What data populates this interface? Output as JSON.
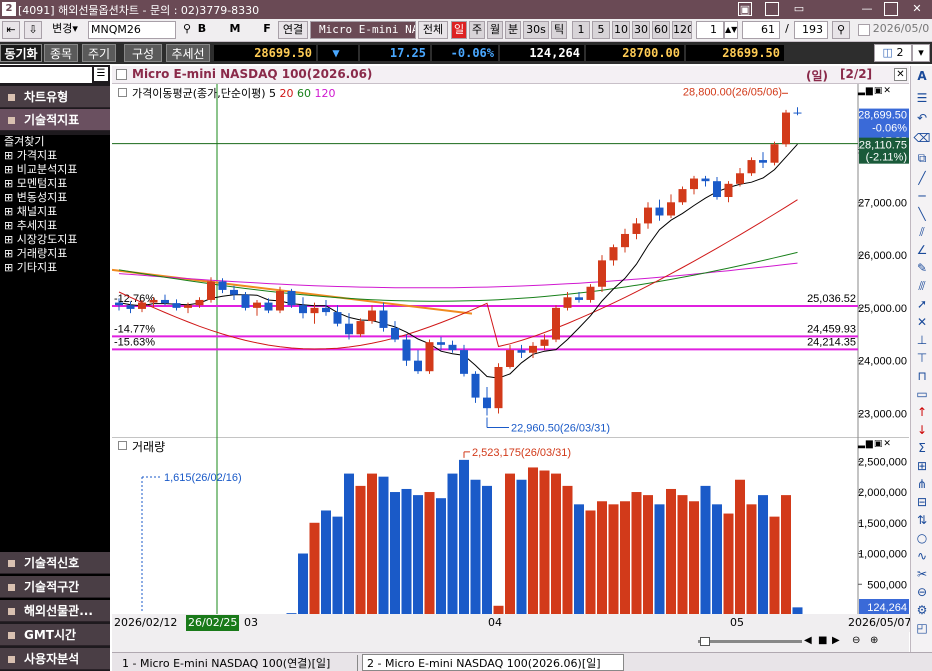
{
  "titlebar": {
    "title": "[4091] 해외선물옵션차트 - 문의 : 02)3779-8330",
    "num": "2",
    "buttons": [
      "▣",
      "□",
      "▭",
      "—",
      "□",
      "✕"
    ]
  },
  "toolbar1": {
    "change_label": "변경",
    "symbol": "MNQM26",
    "b": "B",
    "m": "M",
    "f": "F",
    "link": "연결",
    "name": "Micro E-mini NAS",
    "all": "전체",
    "periods": [
      "일",
      "주",
      "월",
      "분",
      "30s",
      "틱"
    ],
    "nums": [
      "1",
      "5",
      "10",
      "30",
      "60",
      "120"
    ],
    "count_a": "1",
    "count_b": "61",
    "slash": "/",
    "count_c": "193",
    "date": "2026/05/0"
  },
  "toolbar2": {
    "tabs": [
      "동기화",
      "종목",
      "주기",
      "구성",
      "추세선"
    ],
    "price": "28699.50",
    "arrow": "▼",
    "change": "17.25",
    "pct": "-0.06%",
    "volume": "124,264",
    "bid": "28700.00",
    "ask": "28699.50",
    "layout_num": "2"
  },
  "left": {
    "sections_top": [
      "차트유형",
      "기술적지표"
    ],
    "tree": [
      "즐겨찾기",
      "가격지표",
      "비교분석지표",
      "모멘텀지표",
      "변동성지표",
      "채널지표",
      "추세지표",
      "시장강도지표",
      "거래량지표",
      "기타지표"
    ],
    "sections_bottom": [
      "기술적신호",
      "기술적구간",
      "해외선물관...",
      "GMT시간",
      "사용자분석"
    ]
  },
  "chart": {
    "title": "Micro E-mini NASDAQ 100(2026.06)",
    "period": "(일)",
    "page": "[2/2]",
    "ma_label": "가격이동평균(종가,단순이평)",
    "ma_periods": [
      "5",
      "20",
      "60",
      "120"
    ],
    "ma_colors": [
      "#000000",
      "#d01818",
      "#18801a",
      "#d018d0"
    ],
    "y_ticks": [
      "28,000.00",
      "27,000.00",
      "26,000.00",
      "25,000.00",
      "24,000.00",
      "23,000.00"
    ],
    "price_tag": "28,699.50",
    "price_tag2": "-0.06%",
    "price_tag3": "▼17.25",
    "cross_tag": "28,110.75",
    "cross_tag2": "(-2.11%)",
    "high_note": "28,800.00(26/05/06)",
    "low_note": "22,960.50(26/03/31)",
    "levels": [
      {
        "pct": "-12.76%",
        "value": "25,036.52"
      },
      {
        "pct": "-14.77%",
        "value": "24,459.93"
      },
      {
        "pct": "-15.63%",
        "value": "24,214.35"
      }
    ]
  },
  "volume": {
    "title": "거래량",
    "y_ticks": [
      "2,500,000",
      "2,000,000",
      "1,500,000",
      "1,000,000",
      "500,000"
    ],
    "max_note": "2,523,175(26/03/31)",
    "min_note": "1,615(26/02/16)",
    "last_tag": "124,264"
  },
  "xaxis": {
    "start": "2026/02/12",
    "cursor": "26/02/25",
    "m03": "03",
    "m04": "04",
    "m05": "05",
    "end": "2026/05/07"
  },
  "tabs": [
    "1 - Micro E-mini NASDAQ 100(연결)[일]",
    "2 - Micro E-mini NASDAQ 100(2026.06)[일]"
  ],
  "chart_data": {
    "type": "candlestick",
    "candles": [
      [
        25100,
        25180,
        24950,
        25050
      ],
      [
        25050,
        25120,
        24900,
        24980
      ],
      [
        24980,
        25150,
        24920,
        25100
      ],
      [
        25100,
        25200,
        25000,
        25150
      ],
      [
        25150,
        25250,
        25050,
        25090
      ],
      [
        25090,
        25160,
        24950,
        25000
      ],
      [
        25000,
        25100,
        24900,
        25050
      ],
      [
        25050,
        25200,
        25000,
        25150
      ],
      [
        25150,
        25580,
        25100,
        25500
      ],
      [
        25500,
        25560,
        25280,
        25340
      ],
      [
        25340,
        25420,
        25150,
        25250
      ],
      [
        25250,
        25300,
        24950,
        25000
      ],
      [
        25000,
        25150,
        24850,
        25100
      ],
      [
        25100,
        25180,
        24900,
        24950
      ],
      [
        24950,
        25400,
        24900,
        25320
      ],
      [
        25320,
        25360,
        25000,
        25050
      ],
      [
        25050,
        25200,
        24800,
        24900
      ],
      [
        24900,
        25100,
        24700,
        25000
      ],
      [
        25000,
        25150,
        24850,
        24920
      ],
      [
        24920,
        25050,
        24650,
        24700
      ],
      [
        24700,
        24900,
        24400,
        24500
      ],
      [
        24500,
        24800,
        24450,
        24750
      ],
      [
        24750,
        25050,
        24700,
        24950
      ],
      [
        24950,
        25100,
        24550,
        24620
      ],
      [
        24620,
        24750,
        24350,
        24400
      ],
      [
        24400,
        24500,
        23900,
        24000
      ],
      [
        24000,
        24200,
        23750,
        23800
      ],
      [
        23800,
        24400,
        23750,
        24350
      ],
      [
        24350,
        24450,
        24200,
        24300
      ],
      [
        24300,
        24380,
        24150,
        24200
      ],
      [
        24200,
        24300,
        23700,
        23750
      ],
      [
        23750,
        23800,
        23200,
        23300
      ],
      [
        23300,
        23500,
        22960,
        23100
      ],
      [
        23100,
        23950,
        23000,
        23880
      ],
      [
        23880,
        24300,
        23850,
        24200
      ],
      [
        24200,
        24300,
        24050,
        24150
      ],
      [
        24150,
        24350,
        24050,
        24280
      ],
      [
        24280,
        24500,
        24200,
        24400
      ],
      [
        24400,
        25050,
        24350,
        25000
      ],
      [
        25000,
        25300,
        24950,
        25200
      ],
      [
        25200,
        25300,
        25100,
        25150
      ],
      [
        25150,
        25450,
        25100,
        25400
      ],
      [
        25400,
        26000,
        25300,
        25900
      ],
      [
        25900,
        26200,
        25800,
        26150
      ],
      [
        26150,
        26500,
        26050,
        26400
      ],
      [
        26400,
        26700,
        26300,
        26600
      ],
      [
        26600,
        27000,
        26500,
        26900
      ],
      [
        26900,
        27050,
        26650,
        26750
      ],
      [
        26750,
        27150,
        26700,
        27000
      ],
      [
        27000,
        27300,
        26950,
        27250
      ],
      [
        27250,
        27500,
        27150,
        27450
      ],
      [
        27450,
        27500,
        27300,
        27400
      ],
      [
        27400,
        27480,
        27050,
        27100
      ],
      [
        27100,
        27400,
        27000,
        27350
      ],
      [
        27350,
        27650,
        27300,
        27550
      ],
      [
        27550,
        27850,
        27500,
        27800
      ],
      [
        27800,
        27950,
        27650,
        27750
      ],
      [
        27750,
        28150,
        27700,
        28100
      ],
      [
        28100,
        28750,
        28050,
        28700
      ],
      [
        28700,
        28800,
        28650,
        28699.5
      ]
    ],
    "ma5": [
      25100,
      25060,
      25040,
      25080,
      25080,
      25070,
      25060,
      25090,
      25180,
      25220,
      25250,
      25250,
      25240,
      25150,
      25130,
      25080,
      25060,
      25040,
      25040,
      24910,
      24820,
      24770,
      24760,
      24700,
      24640,
      24540,
      24410,
      24320,
      24180,
      24130,
      24100,
      23910,
      23700,
      23670,
      23750,
      23960,
      24120,
      24180,
      24210,
      24400,
      24620,
      24850,
      25130,
      25360,
      25560,
      25830,
      26180,
      26480,
      26660,
      26790,
      26940,
      27080,
      27200,
      27280,
      27340,
      27380,
      27460,
      27620,
      27860,
      28100
    ],
    "volume": [
      1615,
      2100,
      2400,
      2600,
      2300,
      2500,
      2800,
      2900,
      3200,
      3100,
      3000,
      2800,
      2700,
      2600,
      2900,
      30000,
      1000000,
      1500000,
      1700000,
      1600000,
      2300000,
      2100000,
      2300000,
      2250000,
      2000000,
      2050000,
      1950000,
      2000000,
      1900000,
      2300000,
      2523175,
      2200000,
      2100000,
      150000,
      2300000,
      2200000,
      2400000,
      2350000,
      2300000,
      2100000,
      1800000,
      1700000,
      1850000,
      1800000,
      1850000,
      2000000,
      1950000,
      1800000,
      2050000,
      1950000,
      1850000,
      2100000,
      1800000,
      1650000,
      2200000,
      1800000,
      1950000,
      1600000,
      1950000,
      124264
    ],
    "ylim": [
      22800,
      28900
    ],
    "vol_ylim": [
      0,
      2700000
    ]
  }
}
